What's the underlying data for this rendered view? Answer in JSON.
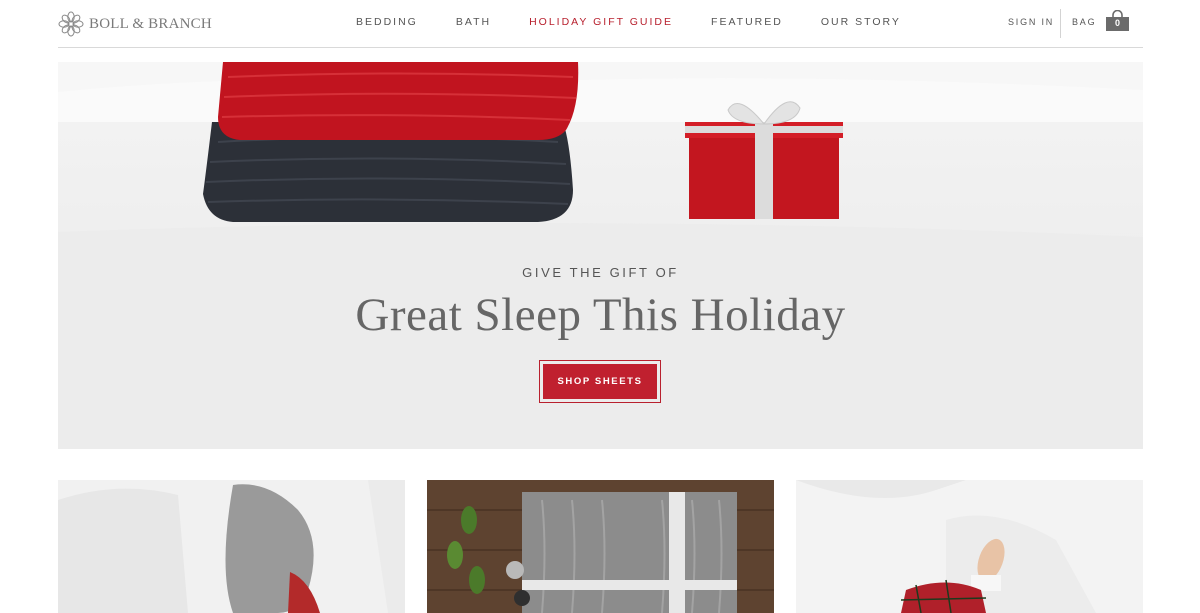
{
  "brand": {
    "name": "BOLL & BRANCH"
  },
  "nav": {
    "items": [
      {
        "label": "BEDDING",
        "active": false
      },
      {
        "label": "BATH",
        "active": false
      },
      {
        "label": "HOLIDAY GIFT GUIDE",
        "active": true
      },
      {
        "label": "FEATURED",
        "active": false
      },
      {
        "label": "OUR STORY",
        "active": false
      }
    ]
  },
  "account": {
    "sign_in": "SIGN IN",
    "bag_label": "BAG",
    "bag_count": "0"
  },
  "hero": {
    "eyebrow": "GIVE THE GIFT OF",
    "title": "Great Sleep This Holiday",
    "cta": "SHOP SHEETS"
  },
  "colors": {
    "accent": "#c0202f",
    "text": "#555555",
    "border": "#d9d9d9"
  }
}
